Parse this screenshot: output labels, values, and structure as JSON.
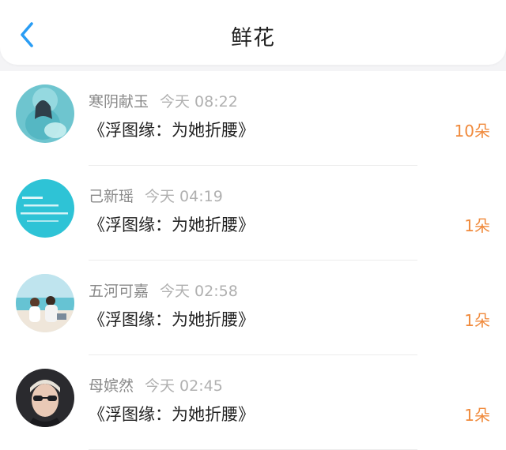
{
  "header": {
    "title": "鲜花",
    "back_icon": "chevron-left-icon",
    "accent_color": "#2a9df4"
  },
  "flowers": [
    {
      "username": "寒阴献玉",
      "time": "今天 08:22",
      "book": "《浮图缘：为她折腰》",
      "count": "10朵",
      "avatar_icon": "illustration-avatar"
    },
    {
      "username": "己新瑶",
      "time": "今天 04:19",
      "book": "《浮图缘：为她折腰》",
      "count": "1朵",
      "avatar_icon": "text-card-avatar"
    },
    {
      "username": "五河可嘉",
      "time": "今天 02:58",
      "book": "《浮图缘：为她折腰》",
      "count": "1朵",
      "avatar_icon": "beach-photo-avatar"
    },
    {
      "username": "母嫔然",
      "time": "今天 02:45",
      "book": "《浮图缘：为她折腰》",
      "count": "1朵",
      "avatar_icon": "portrait-photo-avatar"
    }
  ],
  "colors": {
    "count": "#f08a3c",
    "username": "#8a8a8a",
    "time": "#b0b0b0"
  }
}
